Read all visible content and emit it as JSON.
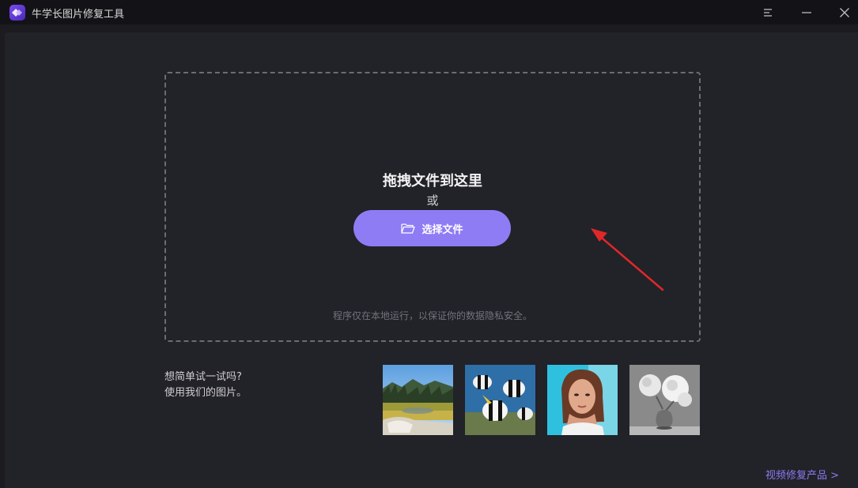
{
  "titlebar": {
    "app_title": "牛学长图片修复工具",
    "icons": [
      "app-logo-icon",
      "menu-icon",
      "minimize-icon",
      "close-icon"
    ]
  },
  "dropzone": {
    "title": "拖拽文件到这里",
    "or_text": "或",
    "choose_button_label": "选择文件",
    "choose_button_icon": "folder-icon",
    "privacy_note": "程序仅在本地运行，以保证你的数据隐私安全。"
  },
  "samples": {
    "prompt_line1": "想简单试一试吗?",
    "prompt_line2": "使用我们的图片。",
    "images": [
      "landscape",
      "fish",
      "portrait",
      "flowers"
    ]
  },
  "footer": {
    "video_link": "视频修复产品 >"
  },
  "colors": {
    "accent": "#8e7cf5",
    "link": "#8a7cf2",
    "annotation_arrow": "#e0282a",
    "background": "#222229",
    "titlebar": "#131317"
  }
}
